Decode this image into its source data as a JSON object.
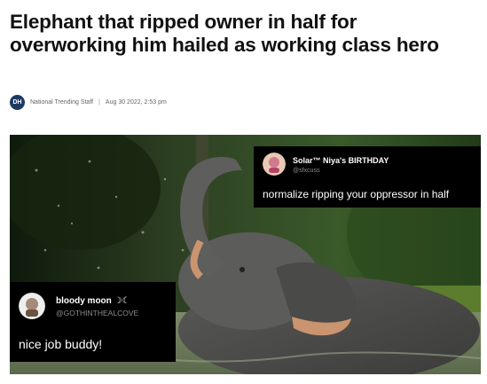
{
  "article": {
    "headline": "Elephant that ripped owner in half for overworking him hailed as working class hero",
    "logo_text": "DH",
    "author": "National Trending Staff",
    "separator": "|",
    "date": "Aug 30 2022, 2:53 pm"
  },
  "tweets": [
    {
      "display_name": "Solar™ Niya's BIRTHDAY",
      "handle": "@sfxcuss",
      "text": "normalize ripping your oppressor in half"
    },
    {
      "display_name": "bloody moon ☽☾",
      "handle": "@GOTHINTHEALCOVE",
      "text": "nice job buddy!"
    }
  ],
  "colors": {
    "logo_bg": "#1c3a63",
    "card_bg": "#000000",
    "handle_gray": "#8a8d91"
  }
}
